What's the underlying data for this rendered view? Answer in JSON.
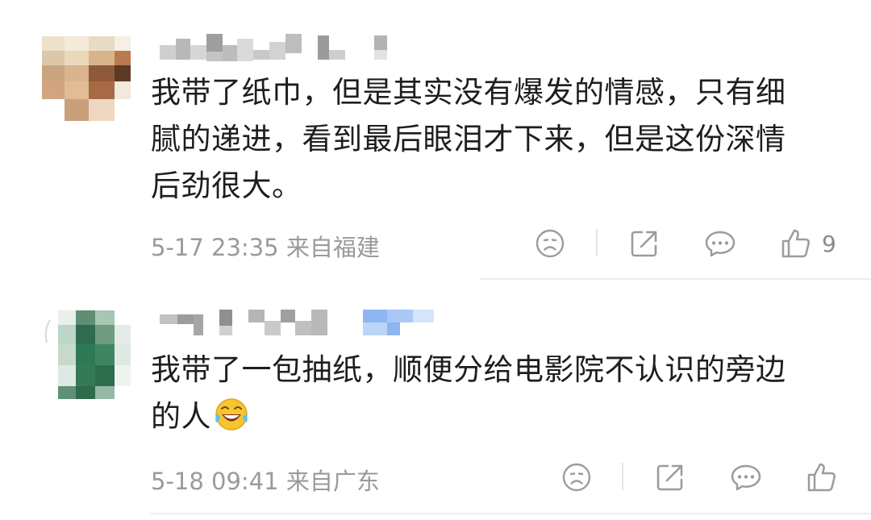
{
  "comments": [
    {
      "text_lines": [
        "我带了纸巾，但是其实没有爆发的情感，只有细",
        "腻的递进，看到最后眼泪才下来，但是这份深情",
        "后劲很大。"
      ],
      "timestamp": "5-17 23:35 来自福建",
      "like_count": "9",
      "actions": [
        "sad-face-icon",
        "share-icon",
        "reply-icon",
        "thumbs-up-icon"
      ]
    },
    {
      "text_lines": [
        "我带了一包抽纸，顺便分给电影院不认识的旁边",
        "的人"
      ],
      "emoji": "laugh-cry-emoji",
      "timestamp": "5-18 09:41 来自广东",
      "like_count": "",
      "actions": [
        "sad-face-icon",
        "share-icon",
        "reply-icon",
        "thumbs-up-icon"
      ]
    }
  ],
  "colors": {
    "text": "#1e1e1e",
    "meta": "#9a9a9a",
    "icon": "#9c9c9c",
    "divider": "#ececec"
  }
}
